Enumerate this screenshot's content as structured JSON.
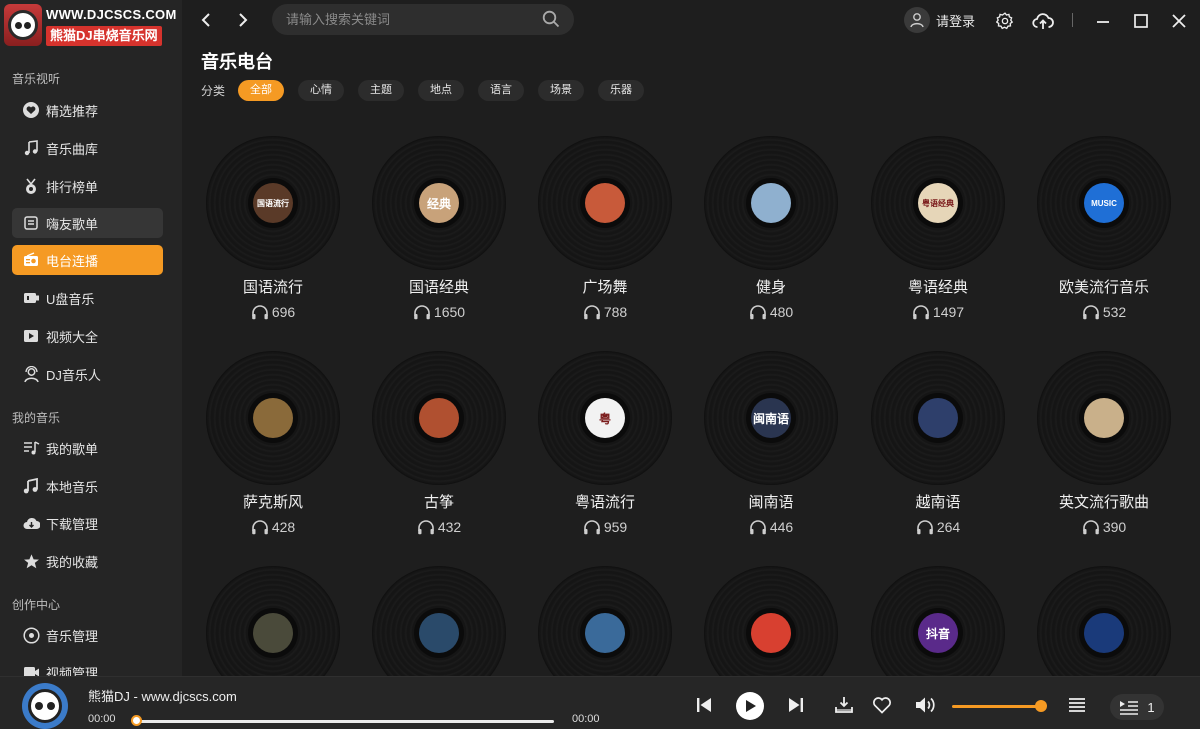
{
  "logo": {
    "url": "WWW.DJCSCS.COM",
    "name": "熊猫DJ串烧音乐网"
  },
  "sidebar": {
    "sections": [
      {
        "title": "音乐视听"
      },
      {
        "title": "我的音乐"
      },
      {
        "title": "创作中心"
      }
    ],
    "items": [
      {
        "label": "精选推荐",
        "icon": "heart-shield-icon"
      },
      {
        "label": "音乐曲库",
        "icon": "music-note-icon"
      },
      {
        "label": "排行榜单",
        "icon": "medal-icon"
      },
      {
        "label": "嗨友歌单",
        "icon": "playlist-icon"
      },
      {
        "label": "电台连播",
        "icon": "radio-icon"
      },
      {
        "label": "U盘音乐",
        "icon": "usb-icon"
      },
      {
        "label": "视频大全",
        "icon": "video-icon"
      },
      {
        "label": "DJ音乐人",
        "icon": "dj-icon"
      },
      {
        "label": "我的歌单",
        "icon": "my-playlist-icon"
      },
      {
        "label": "本地音乐",
        "icon": "local-music-icon"
      },
      {
        "label": "下载管理",
        "icon": "cloud-download-icon"
      },
      {
        "label": "我的收藏",
        "icon": "star-icon"
      },
      {
        "label": "音乐管理",
        "icon": "music-manage-icon"
      },
      {
        "label": "视频管理",
        "icon": "video-manage-icon"
      }
    ]
  },
  "topbar": {
    "search_placeholder": "请输入搜索关键词",
    "login_label": "请登录"
  },
  "main": {
    "title": "音乐电台",
    "category_label": "分类",
    "categories": [
      "全部",
      "心情",
      "主题",
      "地点",
      "语言",
      "场景",
      "乐器"
    ],
    "stations": [
      {
        "name": "国语流行",
        "listeners": "696",
        "cover_text": "国语流行",
        "cover_color": "#5a3a28"
      },
      {
        "name": "国语经典",
        "listeners": "1650",
        "cover_text": "经典",
        "cover_color": "#c8a27a"
      },
      {
        "name": "广场舞",
        "listeners": "788",
        "cover_text": "",
        "cover_color": "#c85a3a"
      },
      {
        "name": "健身",
        "listeners": "480",
        "cover_text": "",
        "cover_color": "#8fb0cf"
      },
      {
        "name": "粤语经典",
        "listeners": "1497",
        "cover_text": "粤语经典",
        "cover_color": "#e6d6b8"
      },
      {
        "name": "欧美流行音乐",
        "listeners": "532",
        "cover_text": "MUSIC",
        "cover_color": "#1f6fd6"
      },
      {
        "name": "萨克斯风",
        "listeners": "428",
        "cover_text": "",
        "cover_color": "#8a6a3a"
      },
      {
        "name": "古筝",
        "listeners": "432",
        "cover_text": "",
        "cover_color": "#b05030"
      },
      {
        "name": "粤语流行",
        "listeners": "959",
        "cover_text": "粤",
        "cover_color": "#f2f2f2"
      },
      {
        "name": "闽南语",
        "listeners": "446",
        "cover_text": "闽南语",
        "cover_color": "#2a3550"
      },
      {
        "name": "越南语",
        "listeners": "264",
        "cover_text": "",
        "cover_color": "#2e3f6b"
      },
      {
        "name": "英文流行歌曲",
        "listeners": "390",
        "cover_text": "",
        "cover_color": "#c9b08a"
      },
      {
        "name": "",
        "listeners": "",
        "cover_text": "",
        "cover_color": "#4a4a3a"
      },
      {
        "name": "",
        "listeners": "",
        "cover_text": "",
        "cover_color": "#2a4a6a"
      },
      {
        "name": "",
        "listeners": "",
        "cover_text": "",
        "cover_color": "#3a6a9a"
      },
      {
        "name": "",
        "listeners": "",
        "cover_text": "",
        "cover_color": "#d84030"
      },
      {
        "name": "",
        "listeners": "",
        "cover_text": "抖音",
        "cover_color": "#5a2a8a"
      },
      {
        "name": "",
        "listeners": "",
        "cover_text": "",
        "cover_color": "#1a3a7a"
      }
    ]
  },
  "player": {
    "track_title": "熊猫DJ - www.djcscs.com",
    "time_current": "00:00",
    "time_total": "00:00",
    "progress": 0,
    "volume": 0.95,
    "queue_count": "1"
  },
  "colors": {
    "accent": "#f59a23",
    "background": "#1e1e1e",
    "sidebar": "#252525"
  }
}
